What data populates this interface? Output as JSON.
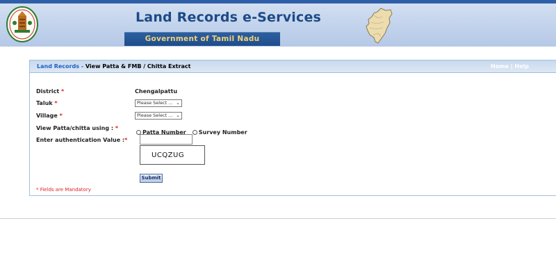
{
  "header": {
    "title": "Land Records e-Services",
    "subtitle": "Government of Tamil Nadu",
    "emblem_icon": "tamil-nadu-emblem-icon",
    "map_icon": "tamil-nadu-map-icon"
  },
  "panel": {
    "crumb_link": "Land Records",
    "crumb_sep": " - ",
    "crumb_title": "View Patta & FMB / Chitta Extract",
    "home_link": "Home",
    "links_sep": " | ",
    "help_link": "Help"
  },
  "form": {
    "district_label": "District",
    "district_value": "Chengalpattu",
    "taluk_label": "Taluk",
    "taluk_selected": "Please Select ...",
    "village_label": "Village",
    "village_selected": "Please Select ...",
    "view_using_label": "View Patta/chitta using :",
    "option_patta": "Patta Number",
    "option_survey": "Survey Number",
    "auth_label": "Enter authentication Value :",
    "auth_value": "",
    "captcha_text": "UCQZUG",
    "required_mark": "*",
    "submit_label": "Submit",
    "mandatory_note": "* Fields are Mandatory"
  },
  "colors": {
    "header_blue": "#c2d3ec",
    "title_blue": "#1c4a86",
    "subtitle_gold": "#f0d27a",
    "required_red": "#e02020"
  }
}
